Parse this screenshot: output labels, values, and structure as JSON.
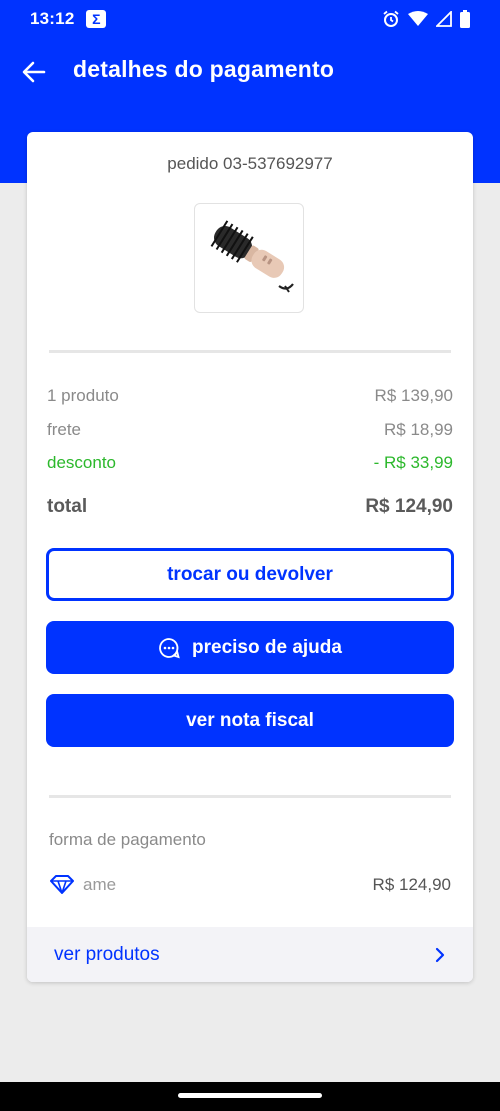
{
  "status_bar": {
    "time": "13:12",
    "app_badge": "Σ",
    "icons": [
      "alarm-icon",
      "wifi-icon",
      "signal-icon",
      "battery-icon"
    ]
  },
  "header": {
    "back_icon": "arrow-left-icon",
    "title": "detalhes do pagamento"
  },
  "order": {
    "number_label": "pedido 03-537692977",
    "product_image": "hair-dryer-brush"
  },
  "summary": {
    "products_label": "1 produto",
    "products_value": "R$ 139,90",
    "shipping_label": "frete",
    "shipping_value": "R$ 18,99",
    "discount_label": "desconto",
    "discount_value": "- R$ 33,99",
    "total_label": "total",
    "total_value": "R$ 124,90"
  },
  "actions": {
    "exchange_label": "trocar ou devolver",
    "help_label": "preciso de ajuda",
    "invoice_label": "ver nota fiscal"
  },
  "payment": {
    "section_label": "forma de pagamento",
    "method_icon": "diamond-icon",
    "method_name": "ame",
    "amount": "R$ 124,90"
  },
  "footer": {
    "link_label": "ver produtos",
    "chevron_icon": "chevron-right-icon"
  },
  "colors": {
    "brand_blue": "#0033ff",
    "discount_green": "#2cb82c",
    "background": "#ececec"
  }
}
